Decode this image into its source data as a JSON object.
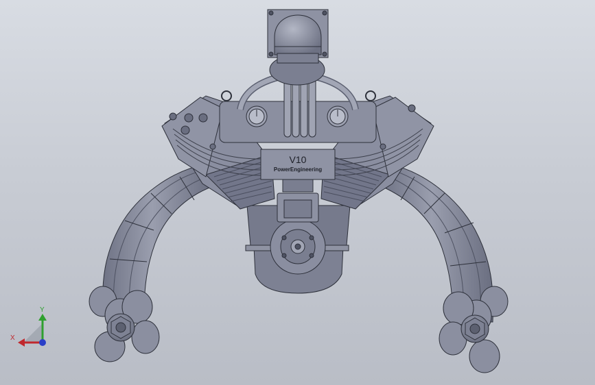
{
  "window": {
    "title": ""
  },
  "model": {
    "badge_title": "V10",
    "badge_subtitle": "PowerEngineering"
  },
  "triad": {
    "x_label": "X",
    "y_label": "Y",
    "x_color": "#c0282d",
    "y_color": "#2fa02f",
    "z_color": "#2a3fc8"
  },
  "colors": {
    "background_top": "#d8dce3",
    "background_bottom": "#b9bdc6",
    "part_fill": "#868a9b",
    "part_dark": "#5f6374",
    "part_light": "#a6aab9",
    "edge": "#2d303a"
  },
  "icons": [
    "triad-icon"
  ]
}
